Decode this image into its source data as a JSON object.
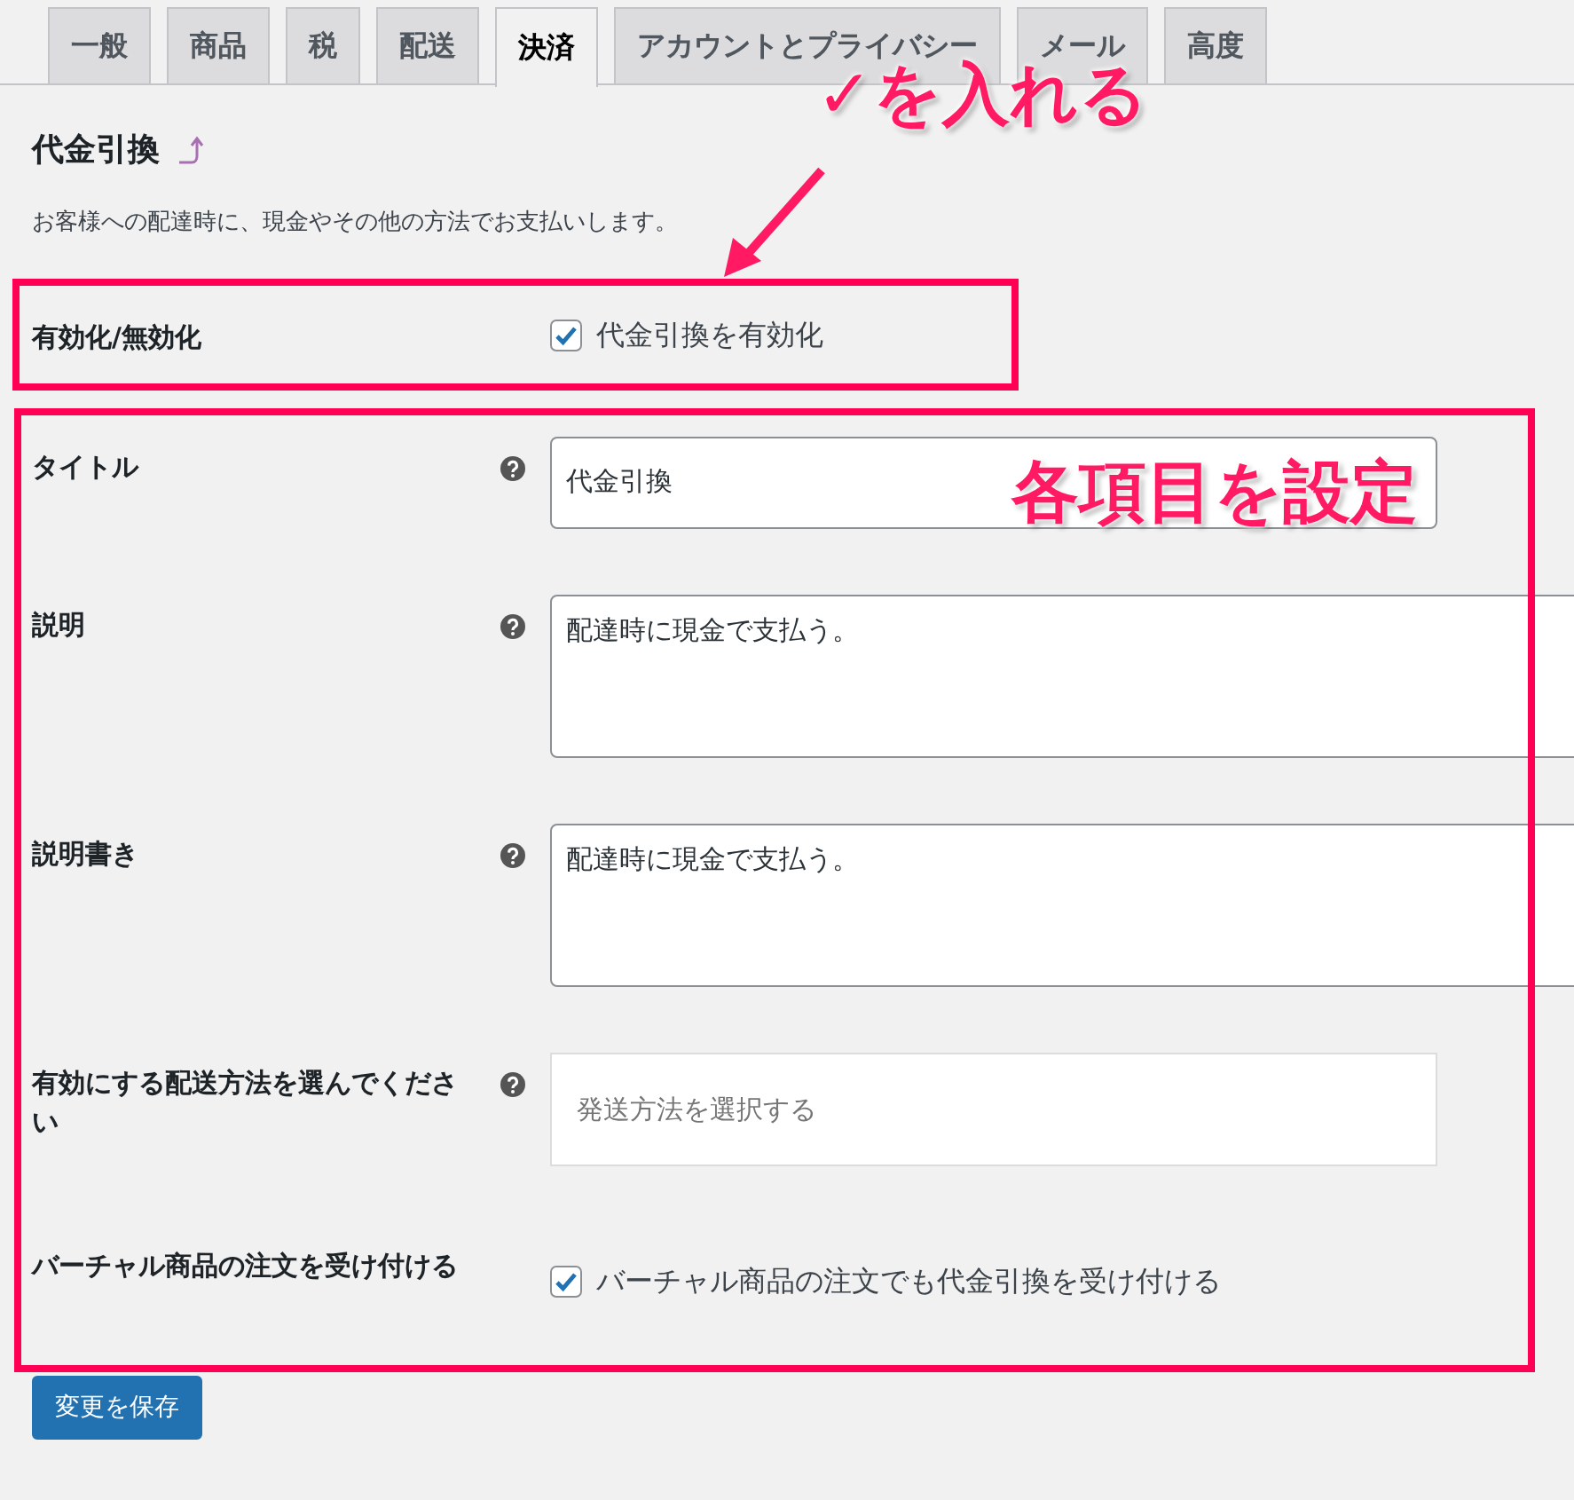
{
  "tabs": [
    {
      "label": "一般",
      "selected": false
    },
    {
      "label": "商品",
      "selected": false
    },
    {
      "label": "税",
      "selected": false
    },
    {
      "label": "配送",
      "selected": false
    },
    {
      "label": "決済",
      "selected": true
    },
    {
      "label": "アカウントとプライバシー",
      "selected": false
    },
    {
      "label": "メール",
      "selected": false
    },
    {
      "label": "高度",
      "selected": false
    }
  ],
  "section": {
    "title": "代金引換",
    "description": "お客様への配達時に、現金やその他の方法でお支払いします。"
  },
  "settings": [
    {
      "kind": "checkbox",
      "label": "有効化/無効化",
      "help": false,
      "text": "代金引換を有効化",
      "checked": true
    },
    {
      "kind": "text",
      "label": "タイトル",
      "help": true,
      "value": "代金引換"
    },
    {
      "kind": "textarea",
      "label": "説明",
      "help": true,
      "value": "配達時に現金で支払う。"
    },
    {
      "kind": "textarea",
      "label": "説明書き",
      "help": true,
      "value": "配達時に現金で支払う。"
    },
    {
      "kind": "select",
      "label": "有効にする配送方法を選んでください",
      "help": true,
      "placeholder": "発送方法を選択する"
    },
    {
      "kind": "checkbox",
      "label": "バーチャル商品の注文を受け付ける",
      "help": false,
      "text": "バーチャル商品の注文でも代金引換を受け付ける",
      "checked": true
    }
  ],
  "save_button": "変更を保存",
  "annotations": [
    {
      "text": "✓を入れる"
    },
    {
      "text": "各項目を設定"
    }
  ]
}
